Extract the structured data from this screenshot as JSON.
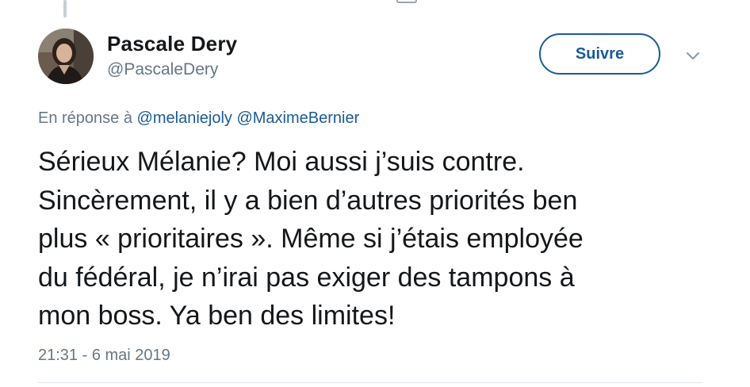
{
  "tweet": {
    "author_name": "Pascale Dery",
    "author_handle": "@PascaleDery",
    "follow_label": "Suivre",
    "reply_prefix": "En réponse à",
    "reply_mentions": [
      "@melaniejoly",
      "@MaximeBernier"
    ],
    "lines": [
      "Sérieux Mélanie? Moi aussi j’suis contre.",
      "Sincèrement, il y a bien d’autres priorités ben",
      "plus « prioritaires ». Même si j’étais employée",
      "du fédéral, je n’irai pas exiger des tampons à",
      "mon boss. Ya ben des limites!"
    ],
    "timestamp": "21:31 - 6 mai 2019"
  },
  "icons": {
    "menu": "chevron-down-icon",
    "avatar": "profile-photo"
  },
  "colors": {
    "link_blue": "#1b5a96",
    "secondary_text": "#657786",
    "primary_text": "#14171a"
  }
}
